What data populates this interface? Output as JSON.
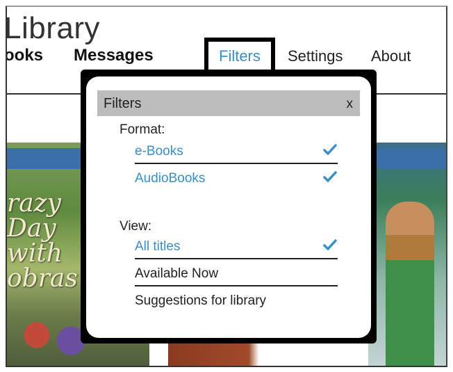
{
  "header": {
    "app_title": "Library",
    "nav": {
      "books": "ooks",
      "messages": "Messages",
      "filters": "Filters",
      "settings": "Settings",
      "about": "About"
    }
  },
  "filters_popup": {
    "title": "Filters",
    "close_label": "x",
    "format": {
      "label": "Format:",
      "options": [
        {
          "label": "e-Books",
          "checked": true
        },
        {
          "label": "AudioBooks",
          "checked": true
        }
      ]
    },
    "view": {
      "label": "View:",
      "options": [
        {
          "label": "All titles",
          "checked": true
        },
        {
          "label": "Available Now",
          "checked": false
        },
        {
          "label": "Suggestions for library",
          "checked": false
        }
      ]
    }
  },
  "colors": {
    "link": "#3a8fc8",
    "header_bar": "#bcbcbc",
    "highlight_border": "#000000"
  },
  "icons": {
    "check": "check-icon",
    "close": "close-icon"
  }
}
